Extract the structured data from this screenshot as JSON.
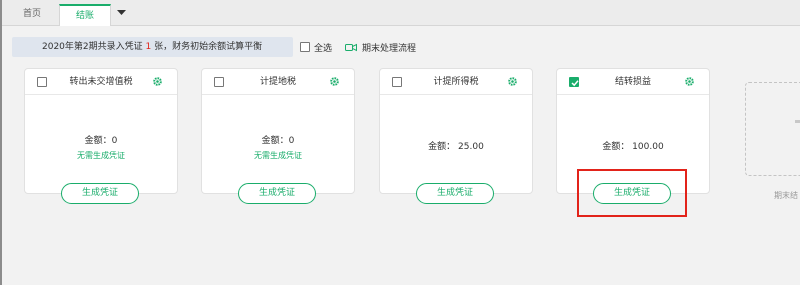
{
  "tabs": {
    "home": "首页",
    "active": "结账",
    "dropdown_icon": "caret-down-icon"
  },
  "info": {
    "prefix": "2020年第2期共录入凭证 ",
    "count": "1",
    "suffix": " 张，财务初始余额试算平衡",
    "select_all": "全选",
    "flow": "期末处理流程"
  },
  "cards": [
    {
      "title": "转出未交增值税",
      "amount": "金额：0",
      "note": "无需生成凭证",
      "button": "生成凭证",
      "checked": false
    },
    {
      "title": "计提地税",
      "amount": "金额：0",
      "note": "无需生成凭证",
      "button": "生成凭证",
      "checked": false
    },
    {
      "title": "计提所得税",
      "amount": "金额： 25.00",
      "note": "",
      "button": "生成凭证",
      "checked": false
    },
    {
      "title": "结转损益",
      "amount": "金额： 100.00",
      "note": "",
      "button": "生成凭证",
      "checked": true
    }
  ],
  "add_card": {
    "label": "期末结"
  },
  "colors": {
    "accent": "#1aad6b",
    "highlight": "#e2231a",
    "info_bg": "#dfe5ee"
  },
  "icons": {
    "gear": "gear-icon",
    "camera": "camera-icon",
    "add": "plus-icon"
  }
}
